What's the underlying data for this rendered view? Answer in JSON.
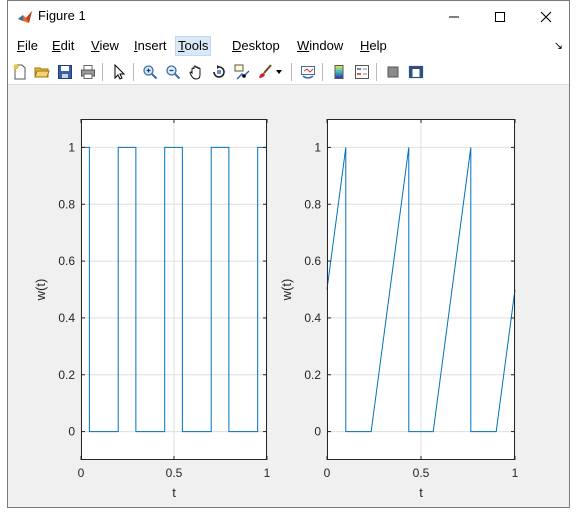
{
  "window": {
    "title": "Figure 1"
  },
  "menu": {
    "items": [
      {
        "first": "F",
        "rest": "ile"
      },
      {
        "first": "E",
        "rest": "dit"
      },
      {
        "first": "V",
        "rest": "iew"
      },
      {
        "first": "I",
        "rest": "nsert"
      },
      {
        "first": "T",
        "rest": "ools"
      },
      {
        "first": "D",
        "rest": "esktop"
      },
      {
        "first": "W",
        "rest": "indow"
      },
      {
        "first": "H",
        "rest": "elp"
      }
    ]
  },
  "toolbar": {
    "icons": [
      "new-figure-icon",
      "open-file-icon",
      "save-icon",
      "print-icon",
      "edit-plot-icon",
      "zoom-in-icon",
      "zoom-out-icon",
      "pan-icon",
      "rotate-3d-icon",
      "data-cursor-icon",
      "brush-icon",
      "link-plot-icon",
      "colorbar-icon",
      "legend-icon",
      "hide-plot-tools-icon",
      "show-plot-tools-icon"
    ]
  },
  "chart_data": [
    {
      "type": "line",
      "title": "",
      "xlabel": "t",
      "ylabel": "w(t)",
      "xlim": [
        0,
        1
      ],
      "ylim": [
        -0.1,
        1.1
      ],
      "xticks": [
        "0",
        "0.5",
        "1"
      ],
      "yticks": [
        "0",
        "0.2",
        "0.4",
        "0.6",
        "0.8",
        "1"
      ],
      "grid": true,
      "series": [
        {
          "color": "#0072bd",
          "x": [
            0,
            0.045,
            0.045,
            0.2,
            0.2,
            0.295,
            0.295,
            0.45,
            0.45,
            0.545,
            0.545,
            0.7,
            0.7,
            0.795,
            0.795,
            0.95,
            0.95,
            1.0
          ],
          "y": [
            1,
            1,
            0,
            0,
            1,
            1,
            0,
            0,
            1,
            1,
            0,
            0,
            1,
            1,
            0,
            0,
            1,
            1
          ]
        }
      ]
    },
    {
      "type": "line",
      "title": "",
      "xlabel": "t",
      "ylabel": "w(t)",
      "xlim": [
        0,
        1
      ],
      "ylim": [
        -0.1,
        1.1
      ],
      "xticks": [
        "0",
        "0.5",
        "1"
      ],
      "yticks": [
        "0",
        "0.2",
        "0.4",
        "0.6",
        "0.8",
        "1"
      ],
      "grid": true,
      "series": [
        {
          "color": "#0072bd",
          "x": [
            0,
            0.1,
            0.1,
            0.235,
            0.435,
            0.435,
            0.565,
            0.765,
            0.765,
            0.9,
            1.0
          ],
          "y": [
            0.5,
            1,
            0,
            0,
            1,
            0,
            0,
            1,
            0,
            0,
            0.5
          ]
        }
      ]
    }
  ]
}
